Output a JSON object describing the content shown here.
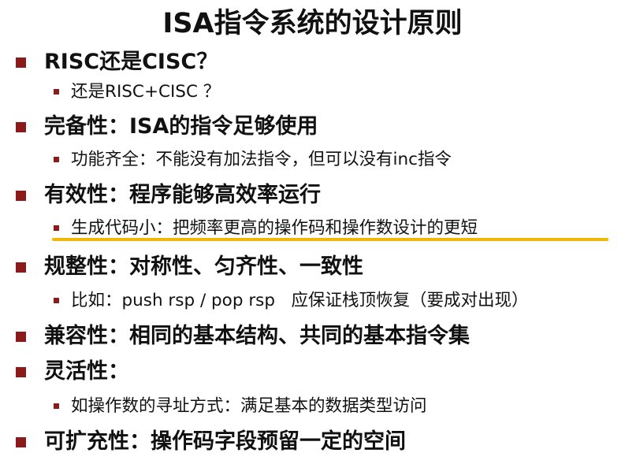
{
  "title": "ISA指令系统的设计原则",
  "items": [
    {
      "level": 1,
      "text": "RISC还是CISC？"
    },
    {
      "level": 2,
      "text": "还是RISC+CISC ？"
    },
    {
      "level": 1,
      "text": "完备性：ISA的指令足够使用"
    },
    {
      "level": 2,
      "text": "功能齐全：不能没有加法指令，但可以没有inc指令"
    },
    {
      "level": 1,
      "text": "有效性：程序能够高效率运行"
    },
    {
      "level": 2,
      "text": "生成代码小：把频率更高的操作码和操作数设计的更短"
    },
    {
      "level": 1,
      "text": "规整性：对称性、匀齐性、一致性"
    },
    {
      "level": 2,
      "text": "比如：push rsp / pop rsp   应保证栈顶恢复（要成对出现）"
    },
    {
      "level": 1,
      "text": "兼容性：相同的基本结构、共同的基本指令集"
    },
    {
      "level": 1,
      "text": "灵活性："
    },
    {
      "level": 2,
      "text": "如操作数的寻址方式：满足基本的数据类型访问"
    },
    {
      "level": 1,
      "text": "可扩充性：操作码字段预留一定的空间"
    }
  ],
  "colors": {
    "bullet": "#8b1a1a",
    "highlight": "#f2b705",
    "text": "#111111"
  }
}
